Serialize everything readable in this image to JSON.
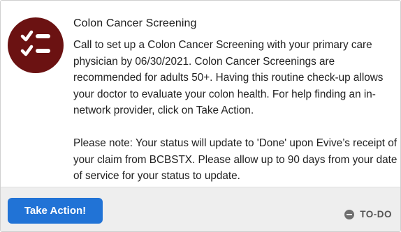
{
  "card": {
    "icon": "checklist-icon",
    "accent_color": "#6b1212",
    "title": "Colon Cancer Screening",
    "body": "Call to set up a Colon Cancer Screening with your primary care physician by 06/30/2021. Colon Cancer Screenings are recommended for adults 50+. Having this routine check-up allows your doctor to evaluate your colon health. For help finding an in-network provider, click on Take Action.",
    "note": "Please note: Your status will update to 'Done' upon Evive’s receipt of your claim from BCBSTX. Please allow up to 90 days from your date of service for your status to update."
  },
  "footer": {
    "action_label": "Take Action!",
    "action_color": "#2173d6",
    "status_icon": "minus-circle-icon",
    "status_label": "TO-DO"
  }
}
